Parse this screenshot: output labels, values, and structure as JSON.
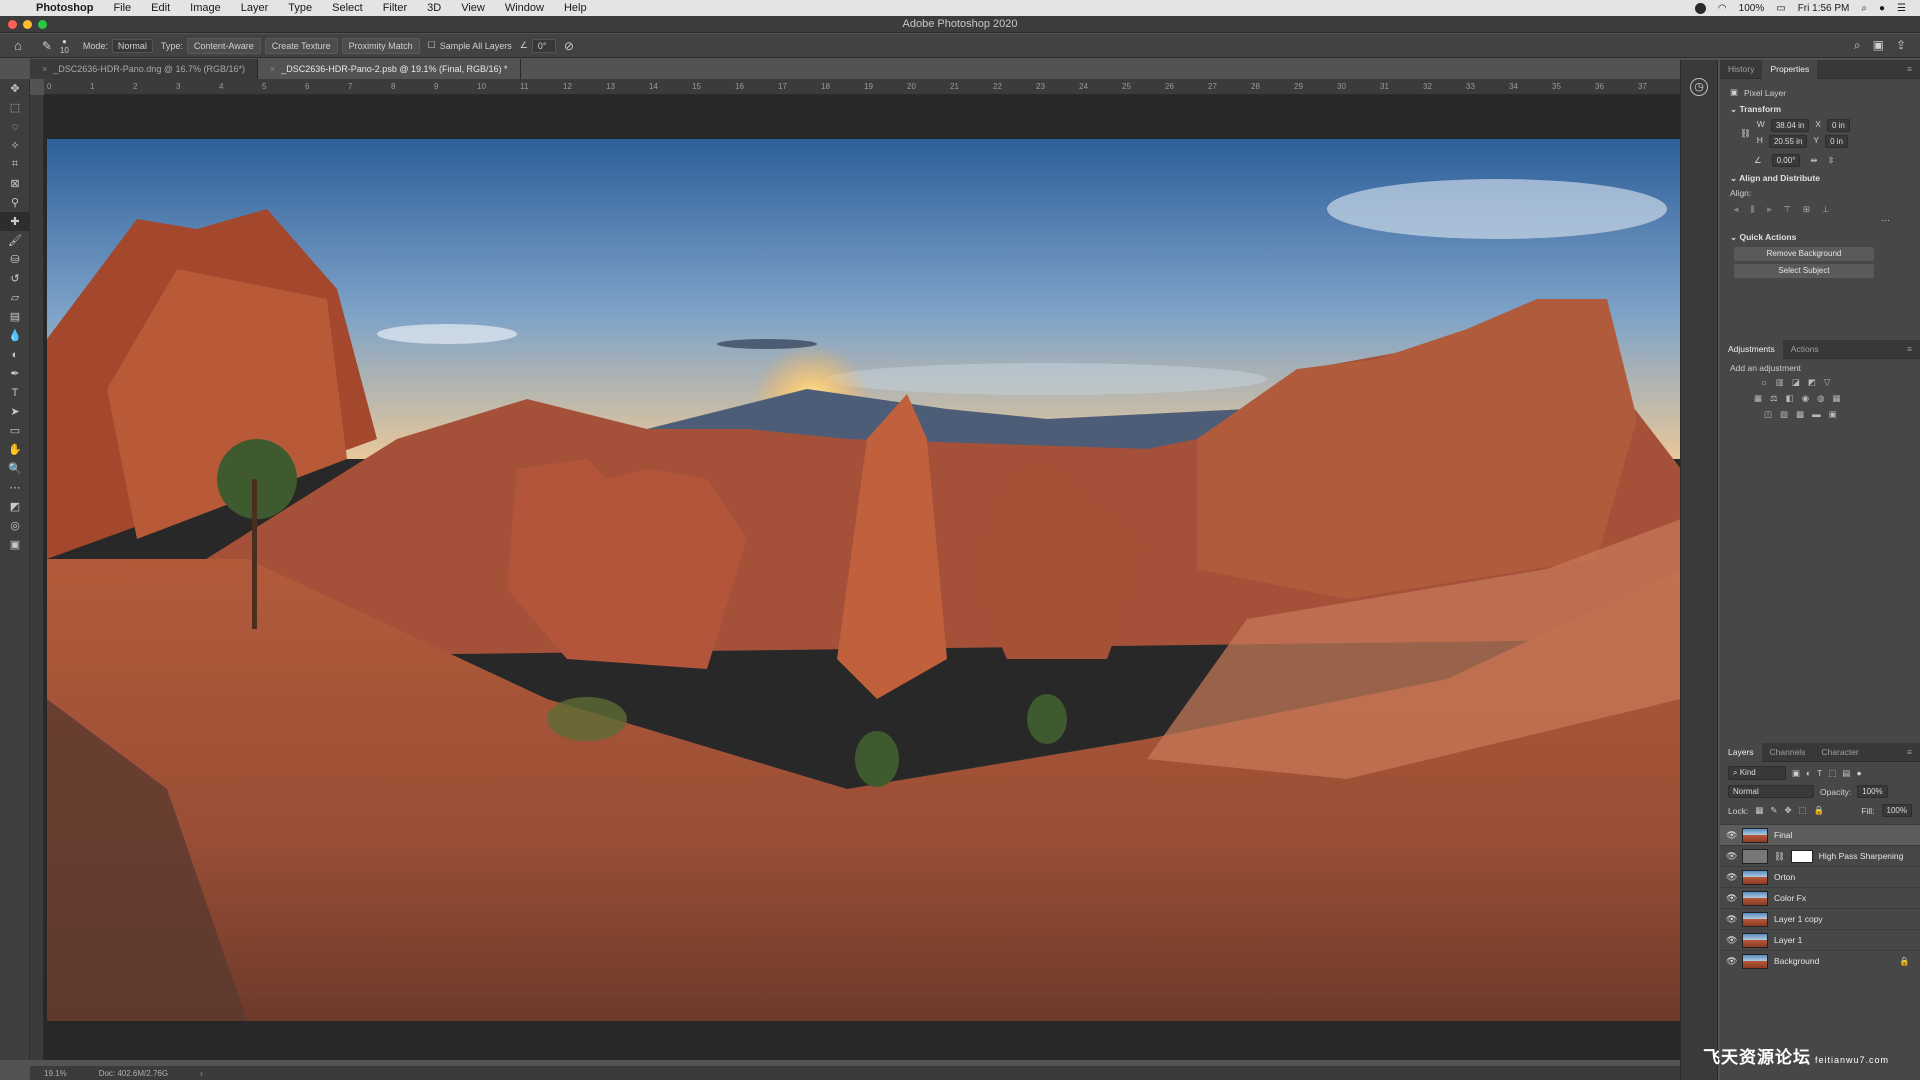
{
  "menubar": {
    "app_name": "Photoshop",
    "items": [
      "File",
      "Edit",
      "Image",
      "Layer",
      "Type",
      "Select",
      "Filter",
      "3D",
      "View",
      "Window",
      "Help"
    ],
    "battery": "100%",
    "clock": "Fri 1:56 PM"
  },
  "window_title": "Adobe Photoshop 2020",
  "options": {
    "mode_label": "Mode:",
    "mode_value": "Normal",
    "type_label": "Type:",
    "type_opts": [
      "Content-Aware",
      "Create Texture",
      "Proximity Match"
    ],
    "sample_all": "Sample All Layers",
    "angle": "0°",
    "brush_size": "10"
  },
  "tabs": [
    "_DSC2636-HDR-Pano.dng @ 16.7% (RGB/16*)",
    "_DSC2636-HDR-Pano-2.psb @ 19.1% (Final, RGB/16) *"
  ],
  "ruler_ticks": [
    "0",
    "1",
    "2",
    "3",
    "4",
    "5",
    "6",
    "7",
    "8",
    "9",
    "10",
    "11",
    "12",
    "13",
    "14",
    "15",
    "16",
    "17",
    "18",
    "19",
    "20",
    "21",
    "22",
    "23",
    "24",
    "25",
    "26",
    "27",
    "28",
    "29",
    "30",
    "31",
    "32",
    "33",
    "34",
    "35",
    "36",
    "37"
  ],
  "status": {
    "zoom": "19.1%",
    "doc": "Doc: 402.6M/2.76G"
  },
  "properties": {
    "tabs": [
      "History",
      "Properties"
    ],
    "layer_type": "Pixel Layer",
    "transform_header": "Transform",
    "w": "38.04 in",
    "h": "20.55 in",
    "x": "0 in",
    "y": "0 in",
    "angle": "0.00°",
    "align_header": "Align and Distribute",
    "align_label": "Align:",
    "quick_header": "Quick Actions",
    "quick_buttons": [
      "Remove Background",
      "Select Subject"
    ]
  },
  "adjustments": {
    "tabs": [
      "Adjustments",
      "Actions"
    ],
    "subtitle": "Add an adjustment"
  },
  "layers_panel": {
    "tabs": [
      "Layers",
      "Channels",
      "Character"
    ],
    "kind": "Kind",
    "blend_mode": "Normal",
    "opacity_label": "Opacity:",
    "opacity": "100%",
    "lock_label": "Lock:",
    "fill_label": "Fill:",
    "fill": "100%",
    "layers": [
      "Final",
      "High Pass Sharpening",
      "Orton",
      "Color Fx",
      "Layer 1 copy",
      "Layer 1",
      "Background"
    ]
  },
  "watermark": {
    "text": "飞天资源论坛",
    "url": "feitianwu7.com"
  }
}
